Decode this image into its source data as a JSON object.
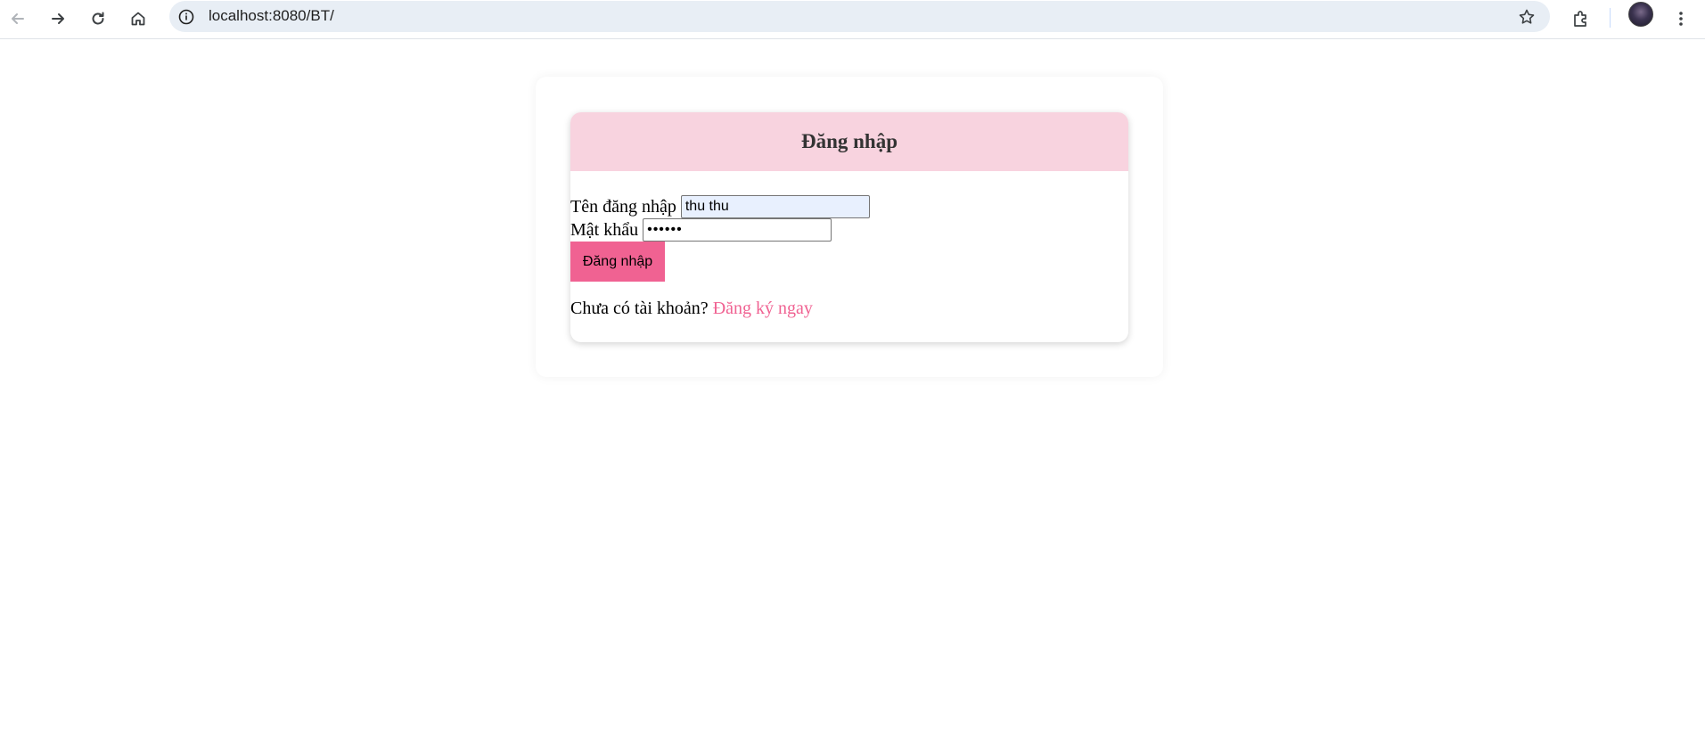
{
  "browser": {
    "url": "localhost:8080/BT/",
    "icons": {
      "back": "arrow-left-icon",
      "forward": "arrow-right-icon",
      "reload": "reload-icon",
      "home": "home-icon",
      "site_info": "info-icon",
      "bookmark": "star-icon",
      "extensions": "puzzle-icon",
      "profile": "avatar",
      "menu": "kebab-menu-icon"
    }
  },
  "login": {
    "title": "Đăng nhập",
    "username_label": "Tên đăng nhập",
    "username_value": "thu thu",
    "password_label": "Mật khẩu",
    "password_value": "••••••",
    "submit_label": "Đăng nhập",
    "register_prompt": "Chưa có tài khoản?",
    "register_link": "Đăng ký ngay"
  },
  "colors": {
    "header_bg": "#f8d3df",
    "accent": "#f06292",
    "autofill_bg": "#e8f0fe"
  }
}
